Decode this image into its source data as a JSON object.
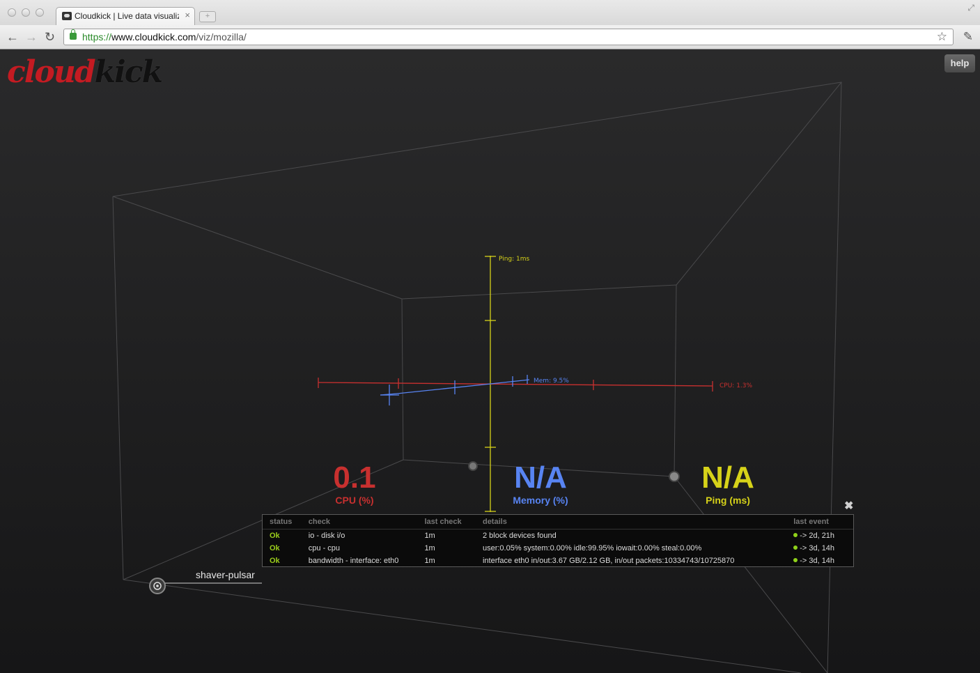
{
  "browser": {
    "tab_title": "Cloudkick | Live data visualiz",
    "tab_close": "×",
    "new_tab": "+",
    "url_scheme": "https://",
    "url_host": "www.cloudkick.com",
    "url_path": "/viz/mozilla/",
    "back": "←",
    "forward": "→",
    "reload": "↻",
    "star": "☆",
    "wrench": "🔧",
    "icons": [
      "back-arrow-icon",
      "forward-arrow-icon",
      "reload-icon",
      "lock-icon",
      "star-icon",
      "wrench-icon",
      "favicon"
    ]
  },
  "page": {
    "logo_part1": "cloud",
    "logo_part2": "kick",
    "help": "help",
    "axis_labels": {
      "ping": "Ping: 1ms",
      "mem": "Mem: 9.5%",
      "cpu": "CPU: 1.3%"
    },
    "metrics": [
      {
        "value": "0.1",
        "label": "CPU (%)",
        "color": "#c8302f"
      },
      {
        "value": "N/A",
        "label": "Memory (%)",
        "color": "#5884f2"
      },
      {
        "value": "N/A",
        "label": "Ping (ms)",
        "color": "#d6d219"
      }
    ],
    "colors": {
      "cpu": "#c8302f",
      "mem": "#5884f2",
      "ping": "#d6d219",
      "ok": "#9acd1b"
    },
    "checks": {
      "close": "✖",
      "headers": [
        "status",
        "check",
        "last check",
        "details",
        "last event"
      ],
      "rows": [
        {
          "status": "Ok",
          "check": "io - disk i/o",
          "last_check": "1m",
          "details": "2 block devices found",
          "last_event": "-> 2d, 21h"
        },
        {
          "status": "Ok",
          "check": "cpu - cpu",
          "last_check": "1m",
          "details": "user:0.05% system:0.00% idle:99.95% iowait:0.00% steal:0.00%",
          "last_event": "-> 3d, 14h"
        },
        {
          "status": "Ok",
          "check": "bandwidth - interface: eth0",
          "last_check": "1m",
          "details": "interface eth0 in/out:3.67 GB/2.12 GB, in/out packets:10334743/10725870",
          "last_event": "-> 3d, 14h"
        }
      ]
    },
    "host_node": "shaver-pulsar"
  }
}
